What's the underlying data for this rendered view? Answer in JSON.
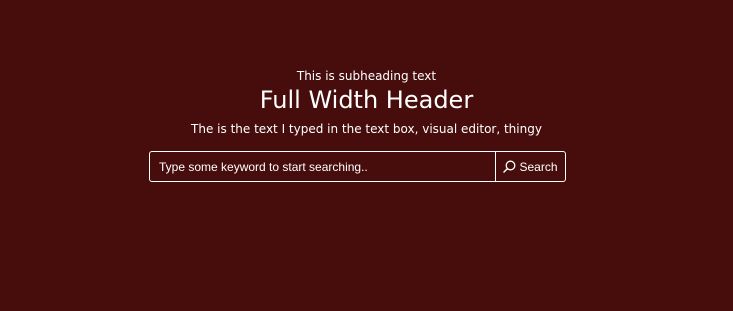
{
  "hero": {
    "subheading": "This is subheading text",
    "title": "Full Width Header",
    "body_text": "The is the text I typed in the text box, visual editor, thingy"
  },
  "search": {
    "placeholder": "Type some keyword to start searching..",
    "value": "",
    "button_label": "Search",
    "button_icon": "search-icon"
  },
  "colors": {
    "background": "#470d0d",
    "text": "#ffffff",
    "border": "#ffffff"
  }
}
